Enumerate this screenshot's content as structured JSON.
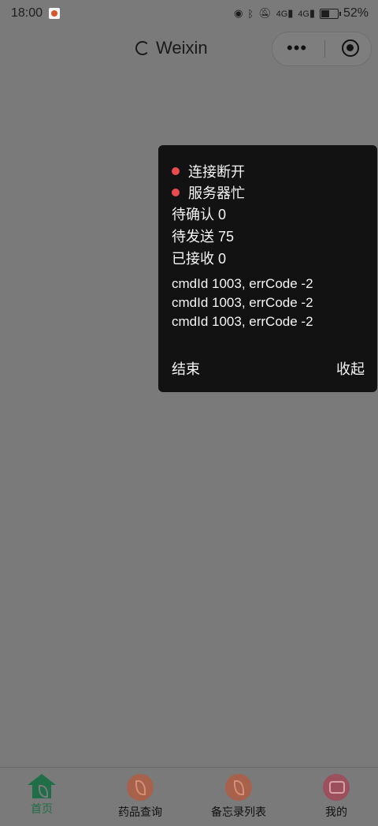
{
  "status_bar": {
    "time": "18:00",
    "network_1": "4G",
    "network_2": "4G",
    "battery": "52%"
  },
  "nav": {
    "title": "Weixin",
    "more_icon": "•••"
  },
  "debug_panel": {
    "status_items": [
      {
        "label": "连接断开",
        "dot_color": "#e94b50"
      },
      {
        "label": "服务器忙",
        "dot_color": "#e94b50"
      }
    ],
    "counters": [
      {
        "text": "待确认 0"
      },
      {
        "text": "待发送 75"
      },
      {
        "text": "已接收 0"
      }
    ],
    "logs": [
      "cmdId 1003, errCode -2",
      "cmdId 1003, errCode -2",
      "cmdId 1003, errCode -2"
    ],
    "end_label": "结束",
    "collapse_label": "收起"
  },
  "tabbar": {
    "tabs": [
      {
        "label": "首页",
        "icon": "home-icon",
        "active": true
      },
      {
        "label": "药品查询",
        "icon": "leaf-icon",
        "active": false
      },
      {
        "label": "备忘录列表",
        "icon": "leaf-icon",
        "active": false
      },
      {
        "label": "我的",
        "icon": "stroller-icon",
        "active": false
      }
    ]
  },
  "colors": {
    "overlay_bg": "#7a7a7a",
    "panel_bg": "#121212",
    "active_tab": "#1f6e47",
    "status_dot": "#e94b50"
  }
}
